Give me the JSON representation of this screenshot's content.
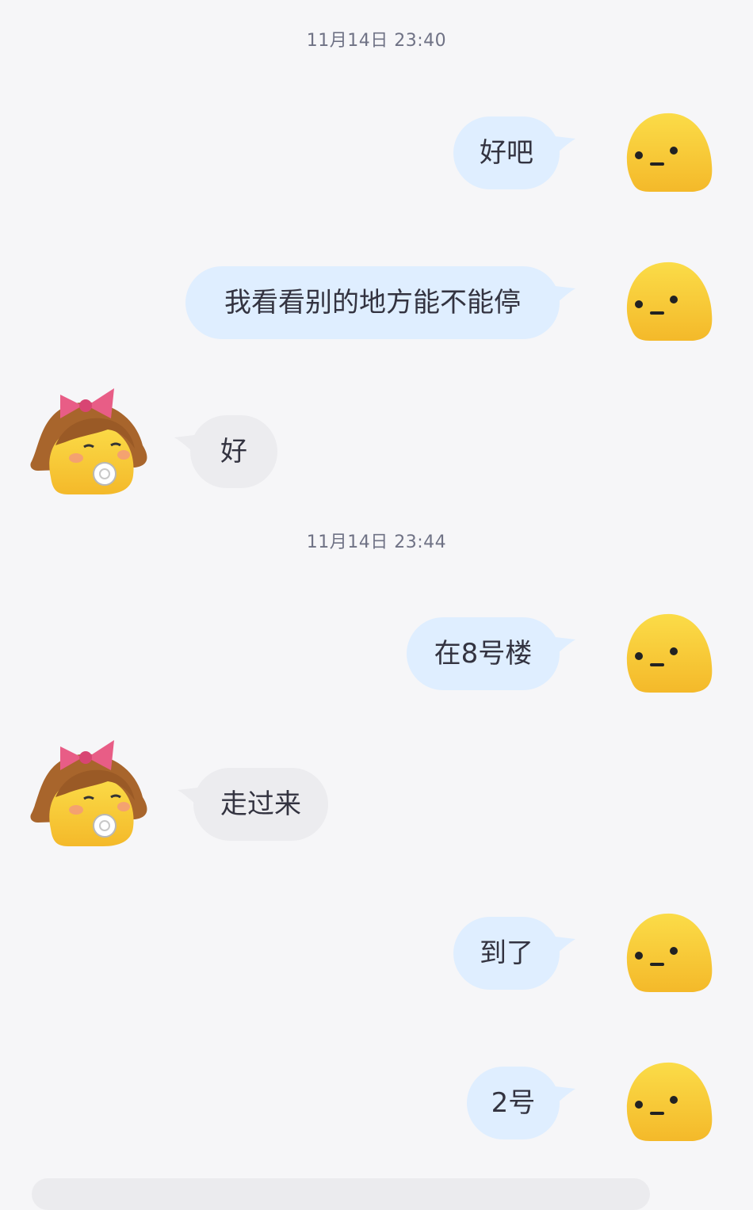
{
  "timestamps": [
    "11月14日 23:40",
    "11月14日 23:44"
  ],
  "messages": [
    {
      "side": "right",
      "text": "好吧"
    },
    {
      "side": "right",
      "text": "我看看别的地方能不能停"
    },
    {
      "side": "left",
      "text": "好"
    },
    {
      "side": "right",
      "text": "在8号楼"
    },
    {
      "side": "left",
      "text": "走过来"
    },
    {
      "side": "right",
      "text": "到了"
    },
    {
      "side": "right",
      "text": "2号"
    }
  ],
  "colors": {
    "background": "#f6f6f8",
    "sent_bubble": "#dfeeff",
    "received_bubble": "#ececef",
    "avatar_yellow": "#f5c531"
  },
  "icons": {
    "self_avatar": "yellow-blob-avatar",
    "contact_avatar": "yellow-girl-bow-pacifier-avatar"
  }
}
